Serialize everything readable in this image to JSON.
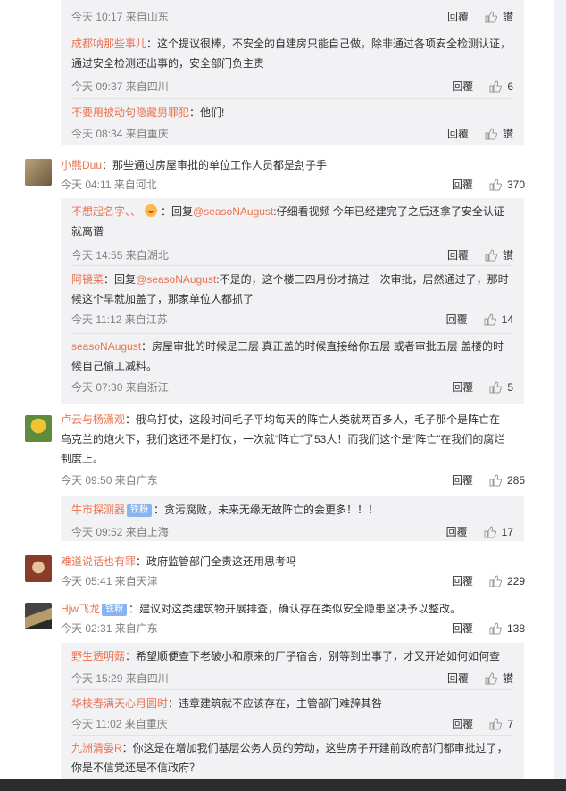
{
  "comments": [
    {
      "meta": {
        "time": "今天 10:17 来自山东",
        "reply": "回覆",
        "like": "讃"
      }
    },
    {
      "user": "成都呐那些事儿",
      "text": "：这个提议很棒，不安全的自建房只能自己做，除非通过各项安全检测认证，通过安全检测还出事的，安全部门负主责",
      "meta": {
        "time": "今天 09:37 来自四川",
        "reply": "回覆",
        "like": "6"
      }
    },
    {
      "user": "不要用被动句隐藏男罪犯",
      "text": "：他们!",
      "meta": {
        "time": "今天 08:34 来自重庆",
        "reply": "回覆",
        "like": "讃"
      }
    },
    {
      "user": "小熊Duu",
      "text": "：那些通过房屋审批的单位工作人员都是刽子手",
      "meta": {
        "time": "今天 04:11 来自河北",
        "reply": "回覆",
        "like": "370"
      }
    },
    {
      "user": "不想起名字、、",
      "text_a": "：回复",
      "at": "@seasoNAugust",
      "text_b": ":仔细看视频 今年已经建完了之后还拿了安全认证就离谱",
      "meta": {
        "time": "今天 14:55 来自湖北",
        "reply": "回覆",
        "like": "讃"
      }
    },
    {
      "user": "阿镜菜",
      "text_a": "：回复",
      "at": "@seasoNAugust",
      "text_b": ":不是的，这个楼三四月份才搞过一次审批，居然通过了，那时候这个早就加盖了，那家单位人都抓了",
      "meta": {
        "time": "今天 11:12 来自江苏",
        "reply": "回覆",
        "like": "14"
      }
    },
    {
      "user": "seasoNAugust",
      "text": "：房屋审批的时候是三层 真正盖的时候直接给你五层 或者审批五层 盖楼的时候自己偷工减料。",
      "meta": {
        "time": "今天 07:30 来自浙江",
        "reply": "回覆",
        "like": "5"
      }
    },
    {
      "user": "卢云与杨潇观",
      "text": "：俄乌打仗，这段时间毛子平均每天的阵亡人类就两百多人，毛子那个是阵亡在乌克兰的炮火下，我们这还不是打仗，一次就“阵亡”了53人！而我们这个是“阵亡”在我们的腐烂制度上。",
      "meta": {
        "time": "今天 09:50 来自广东",
        "reply": "回覆",
        "like": "285"
      }
    },
    {
      "user": "牛市探测器",
      "badge": "铁粉",
      "text": "：贪污腐败，未来无缘无故阵亡的会更多！！！",
      "meta": {
        "time": "今天 09:52 来自上海",
        "reply": "回覆",
        "like": "17"
      }
    },
    {
      "user": "难道说话也有罪",
      "text": "：政府监管部门全责这还用思考吗",
      "meta": {
        "time": "今天 05:41 来自天津",
        "reply": "回覆",
        "like": "229"
      }
    },
    {
      "user": "Hjw飞龙",
      "badge": "铁粉",
      "text": "：建议对这类建筑物开展排查，确认存在类似安全隐患坚决予以整改。",
      "meta": {
        "time": "今天 02:31 来自广东",
        "reply": "回覆",
        "like": "138"
      }
    },
    {
      "user": "野生透明菇",
      "text": "：希望顺便查下老破小和原来的厂子宿舍，别等到出事了，才又开始如何如何查",
      "meta": {
        "time": "今天 15:29 来自四川",
        "reply": "回覆",
        "like": "讃"
      }
    },
    {
      "user": "华枝春满天心月圆时",
      "text": "：违章建筑就不应该存在，主管部门难辞其咎",
      "meta": {
        "time": "今天 11:02 来自重庆",
        "reply": "回覆",
        "like": "7"
      }
    },
    {
      "user": "九洲清晏R",
      "text": "：你这是在增加我们基层公务人员的劳动，这些房子开建前政府部门都审批过了，你是不信党还是不信政府？"
    }
  ],
  "colors": {
    "username": "#eb7350",
    "replybox": "#f2f2f5",
    "badge": "#8ab4f0"
  },
  "icons": {
    "like": "thumbs-up-icon"
  }
}
